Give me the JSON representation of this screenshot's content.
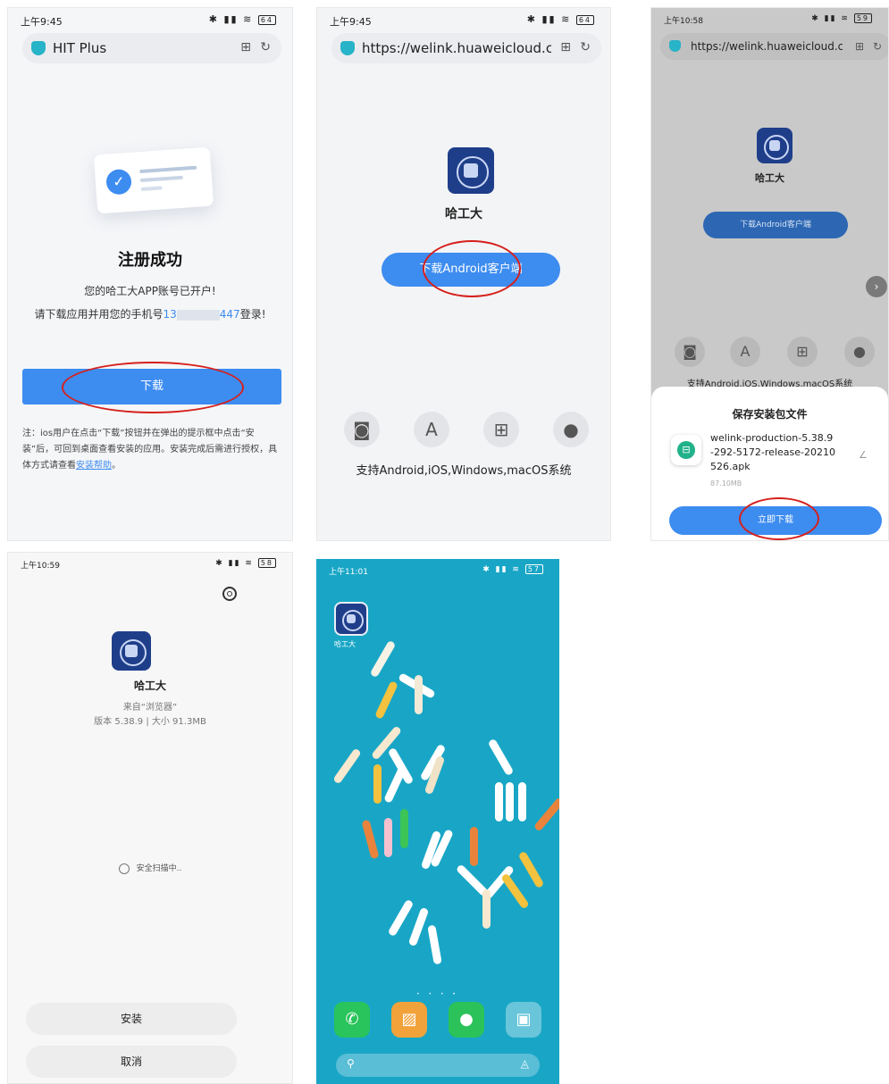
{
  "screen1": {
    "status": {
      "time": "上午9:45",
      "battery": "64"
    },
    "url": "HIT Plus",
    "title": "注册成功",
    "line1": "您的哈工大APP账号已开户!",
    "line2_prefix": "请下载应用并用您的手机号",
    "phone_start": "13",
    "phone_end": "447",
    "line2_suffix": "登录!",
    "download_label": "下载",
    "note_part1": "注：ios用户在点击“下载”按钮并在弹出的提示框中点击“安装”后，可回到桌面查看安装的应用。安装完成后需进行授权，具体方式请查看",
    "note_link": "安装帮助",
    "note_end": "。"
  },
  "screen2": {
    "status": {
      "time": "上午9:45",
      "battery": "64"
    },
    "url": "https://welink.huaweicloud.c",
    "app_name": "哈工大",
    "download_label": "下载Android客户端",
    "platforms_text": "支持Android,iOS,Windows,macOS系统"
  },
  "screen3": {
    "status": {
      "time": "上午10:58",
      "battery": "59"
    },
    "url": "https://welink.huaweicloud.c",
    "app_name": "哈工大",
    "download_label": "下载Android客户端",
    "platforms_text": "支持Android,iOS,Windows,macOS系统",
    "sheet_title": "保存安装包文件",
    "file_name_l1": "welink-production-5.38.9",
    "file_name_l2": "-292-5172-release-20210",
    "file_name_l3": "526.apk",
    "file_size": "87.10MB",
    "confirm_label": "立即下载"
  },
  "screen4": {
    "status": {
      "time": "上午10:59",
      "battery": "58"
    },
    "app_name": "哈工大",
    "source": "来自“浏览器”",
    "version": "版本 5.38.9 | 大小 91.3MB",
    "scanning": "安全扫描中..",
    "install_label": "安装",
    "cancel_label": "取消"
  },
  "screen5": {
    "status": {
      "time": "上午11:01",
      "battery": "57"
    },
    "app_label": "哈工大"
  },
  "colors": {
    "accent_blue": "#3d8cf0",
    "annotation_red": "#d6201c",
    "hit_logo_blue": "#1f3e8a",
    "sea": "#19a6c6"
  }
}
